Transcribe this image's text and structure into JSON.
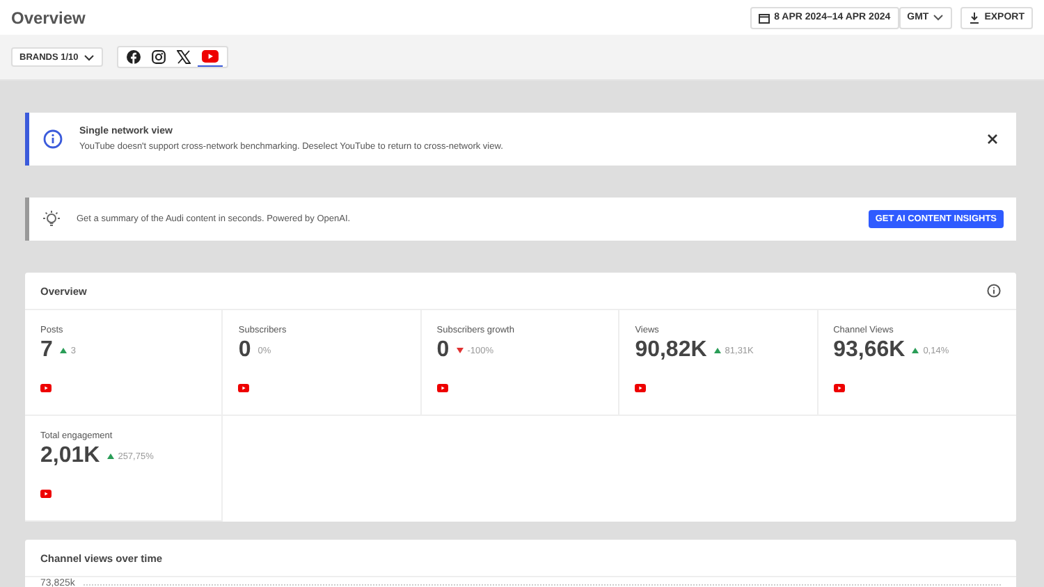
{
  "header": {
    "title": "Overview",
    "date_range": "8 APR 2024–14 APR 2024",
    "timezone": "GMT",
    "export_label": "EXPORT"
  },
  "toolbar": {
    "brands_label": "BRANDS 1/10",
    "networks": [
      {
        "kind": "facebook",
        "selected": false
      },
      {
        "kind": "instagram",
        "selected": false
      },
      {
        "kind": "x",
        "selected": false
      },
      {
        "kind": "youtube",
        "selected": true
      }
    ]
  },
  "notice": {
    "title": "Single network view",
    "text": "YouTube doesn't support cross-network benchmarking. Deselect YouTube to return to cross-network view."
  },
  "ai_banner": {
    "text": "Get a summary of the Audi content in seconds. Powered by OpenAI.",
    "button": "GET AI CONTENT INSIGHTS"
  },
  "overview": {
    "title": "Overview",
    "metrics": [
      {
        "label": "Posts",
        "value": "7",
        "change": "3",
        "kind": "up"
      },
      {
        "label": "Subscribers",
        "value": "0",
        "change": "0%",
        "kind": "flat"
      },
      {
        "label": "Subscribers growth",
        "value": "0",
        "change": "-100%",
        "kind": "down"
      },
      {
        "label": "Views",
        "value": "90,82K",
        "change": "81,31K",
        "kind": "up"
      },
      {
        "label": "Channel Views",
        "value": "93,66K",
        "change": "0,14%",
        "kind": "up"
      },
      {
        "label": "Total engagement",
        "value": "2,01K",
        "change": "257,75%",
        "kind": "up"
      }
    ]
  },
  "channel_views": {
    "title": "Channel views over time",
    "y_label": "73,825k"
  }
}
